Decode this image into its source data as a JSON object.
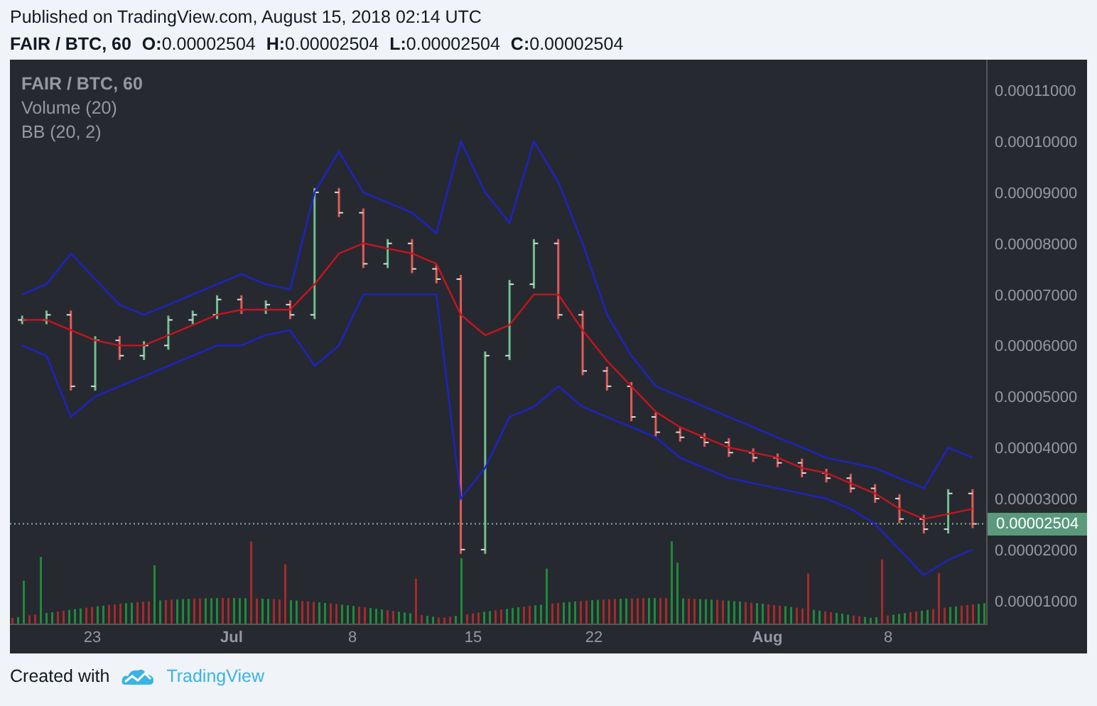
{
  "header": {
    "published": "Published on TradingView.com, August 15, 2018 02:14 UTC",
    "symbol": "FAIR / BTC, 60",
    "ohlc": [
      {
        "label": "O:",
        "value": "0.00002504"
      },
      {
        "label": "H:",
        "value": "0.00002504"
      },
      {
        "label": "L:",
        "value": "0.00002504"
      },
      {
        "label": "C:",
        "value": "0.00002504"
      }
    ]
  },
  "legend": [
    {
      "kind": "symbol",
      "text": "FAIR / BTC, 60"
    },
    {
      "kind": "study",
      "text": "Volume (20)"
    },
    {
      "kind": "study",
      "text": "BB (20, 2)"
    }
  ],
  "chart_data": {
    "type": "line",
    "ylim": [
      5.5e-06,
      0.000116
    ],
    "yticks": [
      {
        "value": 0.00011,
        "label": "0.00011000"
      },
      {
        "value": 0.0001,
        "label": "0.00010000"
      },
      {
        "value": 9e-05,
        "label": "0.00009000"
      },
      {
        "value": 8e-05,
        "label": "0.00008000"
      },
      {
        "value": 7e-05,
        "label": "0.00007000"
      },
      {
        "value": 6e-05,
        "label": "0.00006000"
      },
      {
        "value": 5e-05,
        "label": "0.00005000"
      },
      {
        "value": 4e-05,
        "label": "0.00004000"
      },
      {
        "value": 3e-05,
        "label": "0.00003000"
      },
      {
        "value": 2e-05,
        "label": "0.00002000"
      },
      {
        "value": 1e-05,
        "label": "0.00001000"
      }
    ],
    "series": [
      {
        "color": "#1e22c8",
        "values": [
          7e-05,
          7.2e-05,
          7.8e-05,
          7.3e-05,
          6.8e-05,
          6.6e-05,
          6.8e-05,
          7e-05,
          7.2e-05,
          7.4e-05,
          7.2e-05,
          7.1e-05,
          9e-05,
          9.8e-05,
          9e-05,
          8.8e-05,
          8.6e-05,
          8.2e-05,
          0.0001,
          9e-05,
          8.4e-05,
          0.0001,
          9.2e-05,
          8e-05,
          6.6e-05,
          5.8e-05,
          5.2e-05,
          5e-05,
          4.8e-05,
          4.6e-05,
          4.4e-05,
          4.2e-05,
          4e-05,
          3.8e-05,
          3.7e-05,
          3.6e-05,
          3.4e-05,
          3.2e-05,
          4e-05,
          3.8e-05
        ]
      },
      {
        "color": "#c8141e",
        "values": [
          6.5e-05,
          6.5e-05,
          6.3e-05,
          6.1e-05,
          6e-05,
          6e-05,
          6.2e-05,
          6.4e-05,
          6.6e-05,
          6.7e-05,
          6.7e-05,
          6.7e-05,
          7.2e-05,
          7.8e-05,
          8e-05,
          7.9e-05,
          7.8e-05,
          7.6e-05,
          6.6e-05,
          6.2e-05,
          6.4e-05,
          7e-05,
          7e-05,
          6.3e-05,
          5.7e-05,
          5.2e-05,
          4.7e-05,
          4.4e-05,
          4.2e-05,
          4e-05,
          3.9e-05,
          3.8e-05,
          3.6e-05,
          3.5e-05,
          3.3e-05,
          3.1e-05,
          2.8e-05,
          2.6e-05,
          2.7e-05,
          2.8e-05
        ]
      },
      {
        "color": "#1e22c8",
        "values": [
          6e-05,
          5.8e-05,
          4.6e-05,
          5e-05,
          5.2e-05,
          5.4e-05,
          5.6e-05,
          5.8e-05,
          6e-05,
          6e-05,
          6.2e-05,
          6.3e-05,
          5.6e-05,
          6e-05,
          7e-05,
          7e-05,
          7e-05,
          7e-05,
          3e-05,
          3.6e-05,
          4.6e-05,
          4.8e-05,
          5.2e-05,
          4.8e-05,
          4.6e-05,
          4.4e-05,
          4.2e-05,
          3.8e-05,
          3.6e-05,
          3.4e-05,
          3.3e-05,
          3.2e-05,
          3.1e-05,
          3e-05,
          2.8e-05,
          2.5e-05,
          2e-05,
          1.5e-05,
          1.8e-05,
          2e-05
        ]
      }
    ]
  },
  "price_axis": {
    "last_price": "0.00002504"
  },
  "time_axis": {
    "ticks": [
      {
        "label": "23",
        "month": false
      },
      {
        "label": "Jul",
        "month": true
      },
      {
        "label": "8",
        "month": false
      },
      {
        "label": "15",
        "month": false
      },
      {
        "label": "22",
        "month": false
      },
      {
        "label": "Aug",
        "month": true
      },
      {
        "label": "8",
        "month": false
      }
    ]
  },
  "footer": {
    "text": "Created with",
    "brand": "TradingView"
  }
}
